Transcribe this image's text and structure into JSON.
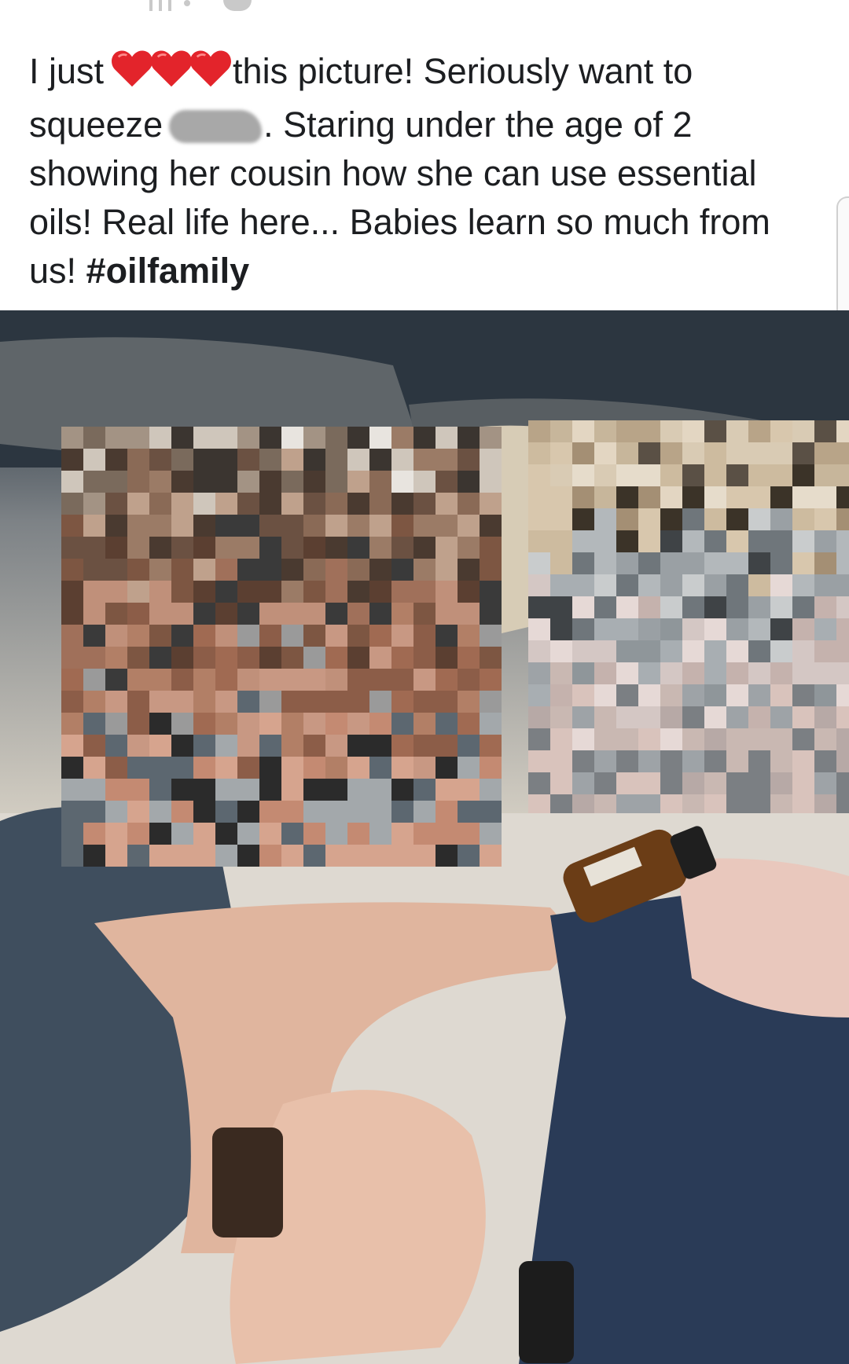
{
  "post": {
    "text_before_hearts": "I just",
    "hearts_icon": "red-heart-icon",
    "heart_color": "#e3242b",
    "heart_count": 3,
    "text_after_hearts": "this picture! Seriously want to squeeze",
    "redacted_name_icon": "redacted-name-blur",
    "text_after_name": ". Staring under the age of 2 showing her cousin how she can use essential oils! Real life here... Babies learn so much from us!",
    "hashtag": "#oilfamily"
  },
  "photo": {
    "description_icon": "shared-photo",
    "pixelated_regions": 2
  },
  "colors": {
    "text": "#1c1e21",
    "background": "#ffffff"
  }
}
